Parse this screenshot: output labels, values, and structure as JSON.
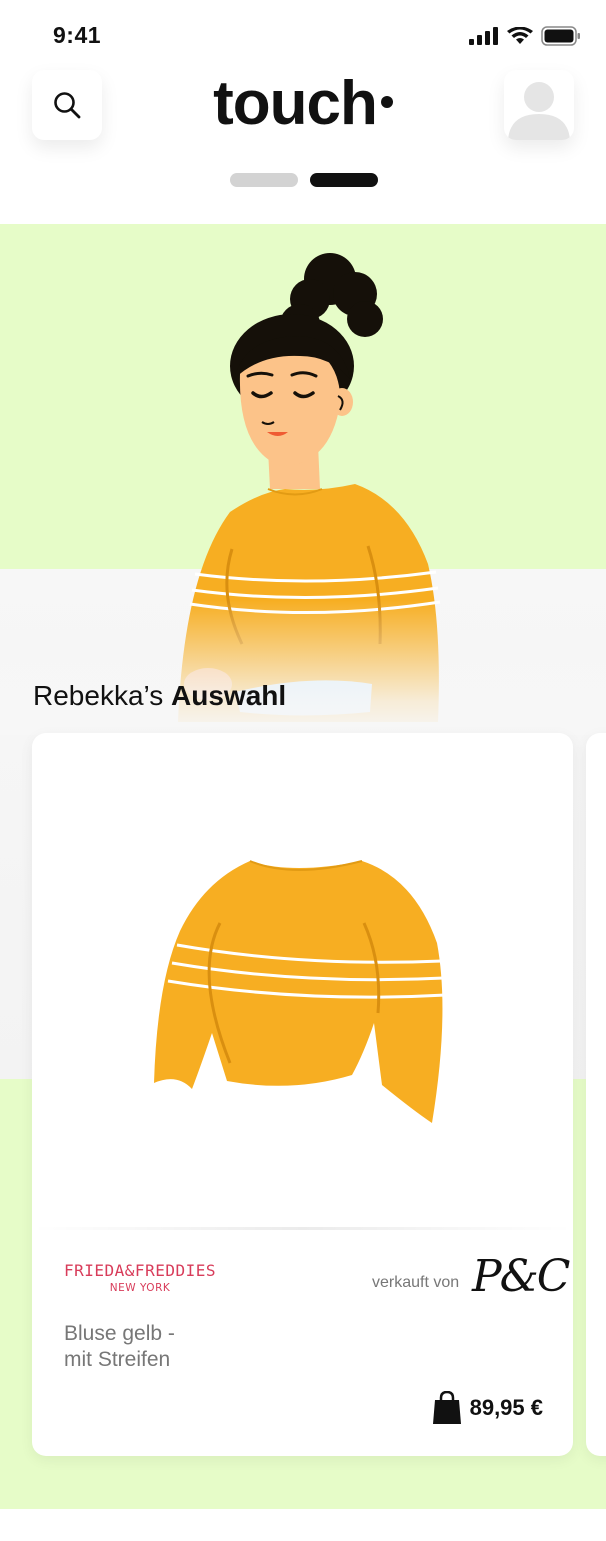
{
  "status_bar": {
    "time": "9:41"
  },
  "header": {
    "logo": "touch",
    "pager": {
      "pages": 2,
      "active": 2
    }
  },
  "section": {
    "owner": "Rebekka’s",
    "title": "Auswahl"
  },
  "product": {
    "brand_name": "FRIEDA&FREDDIES",
    "brand_sub": "NEW YORK",
    "sold_by_label": "verkauft von",
    "seller": "P&C",
    "name_line1": "Bluse gelb -",
    "name_line2": "mit Streifen",
    "price": "89,95 €"
  },
  "colors": {
    "hero_green": "#e6fcc8",
    "sweater_yellow": "#f7ae22",
    "brand_pink": "#d83c5a",
    "text_dark": "#111111"
  },
  "icons": [
    "search-icon",
    "avatar-icon",
    "shopping-bag-icon",
    "signal-icon",
    "wifi-icon",
    "battery-icon"
  ]
}
